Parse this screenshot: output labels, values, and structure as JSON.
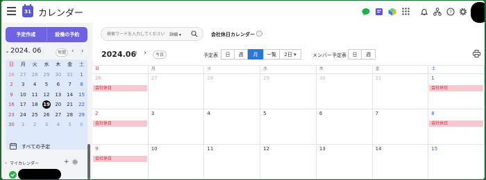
{
  "app": {
    "title": "カレンダー",
    "logo_day": "31",
    "accent": "#6e63e3"
  },
  "header": {
    "icons": [
      "chat-icon",
      "note-icon",
      "cube-icon",
      "apps-grid-icon",
      "bell-icon",
      "org-icon",
      "help-icon",
      "settings-icon"
    ]
  },
  "sidebar": {
    "create_label": "予定作成",
    "facility_label": "設備の予約",
    "month_label": "2024. 06",
    "year_label": "年間",
    "weekdays": [
      "日",
      "月",
      "火",
      "水",
      "木",
      "金",
      "土"
    ],
    "weeks": [
      [
        "26",
        "27",
        "28",
        "29",
        "30",
        "31",
        "1"
      ],
      [
        "2",
        "3",
        "4",
        "5",
        "6",
        "7",
        "8"
      ],
      [
        "9",
        "10",
        "11",
        "12",
        "13",
        "14",
        "15"
      ],
      [
        "16",
        "17",
        "18",
        "19",
        "20",
        "21",
        "22"
      ],
      [
        "23",
        "24",
        "25",
        "26",
        "27",
        "28",
        "29"
      ],
      [
        "30",
        "1",
        "2",
        "3",
        "4",
        "5",
        "6"
      ]
    ],
    "all_events_label": "すべての予定",
    "my_calendar_label": "マイカレンダー"
  },
  "toolbar": {
    "search_placeholder": "検索ワードを入力してください",
    "search_detail": "詳細",
    "calendar_name": "会社休日カレンダー",
    "month_title": "2024.06",
    "today_label": "今日",
    "schedule_label": "予定表",
    "view_day": "日",
    "view_week": "週",
    "view_month": "月",
    "view_list": "一覧",
    "view_2day": "2日",
    "member_label": "メンバー予定表",
    "member_day": "日",
    "member_week": "週"
  },
  "calendar": {
    "weekday_headers": [
      "日",
      "月",
      "火",
      "水",
      "木",
      "金",
      "土"
    ],
    "weeks": [
      [
        "26",
        "27",
        "28",
        "29",
        "30",
        "31",
        "1"
      ],
      [
        "2",
        "3",
        "4",
        "5",
        "6",
        "7",
        "8"
      ],
      [
        "9",
        "10",
        "11",
        "12",
        "13",
        "14",
        "15"
      ]
    ],
    "events": [
      {
        "week": 0,
        "day": 0,
        "label": "会社休日"
      },
      {
        "week": 0,
        "day": 6,
        "label": "会社休日"
      },
      {
        "week": 1,
        "day": 0,
        "label": "会社休日"
      },
      {
        "week": 1,
        "day": 6,
        "label": "会社休日"
      },
      {
        "week": 2,
        "day": 0,
        "label": "会社休日"
      }
    ]
  }
}
